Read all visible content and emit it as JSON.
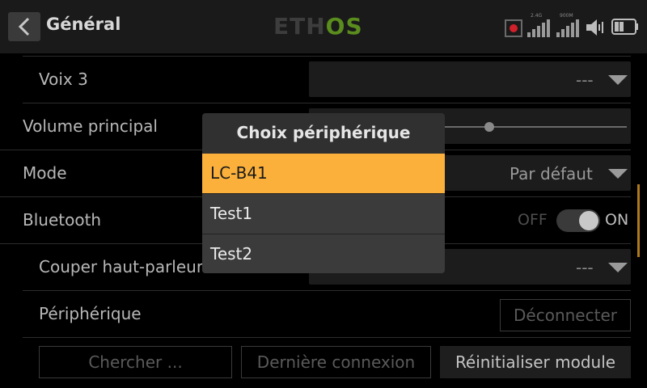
{
  "header": {
    "title": "Général",
    "logo_left": "ETH",
    "logo_right": "OS",
    "signal1_label": "2.4G",
    "signal2_label": "900M",
    "icons": [
      "back-chevron-icon",
      "record-icon",
      "signal-icon",
      "volume-icon",
      "battery-icon"
    ]
  },
  "rows": {
    "voix3_label": "Voix 3",
    "voix3_value": "---",
    "volume_label": "Volume principal",
    "mode_label": "Mode",
    "mode_value": "Par défaut",
    "bluetooth_label": "Bluetooth",
    "bluetooth_off": "OFF",
    "bluetooth_on": "ON",
    "couper_label": "Couper haut-parleur",
    "couper_value": "---",
    "peripherique_label": "Périphérique",
    "deconnecter_label": "Déconnecter"
  },
  "buttons": {
    "chercher": "Chercher ...",
    "derniere": "Dernière connexion",
    "reinit": "Réinitialiser module"
  },
  "modal": {
    "title": "Choix périphérique",
    "options": [
      "LC-B41",
      "Test1",
      "Test2"
    ],
    "selected_index": 0
  },
  "colors": {
    "accent": "#fbb03b",
    "logo_green": "#5a8c1e",
    "record_red": "#d0202a"
  }
}
